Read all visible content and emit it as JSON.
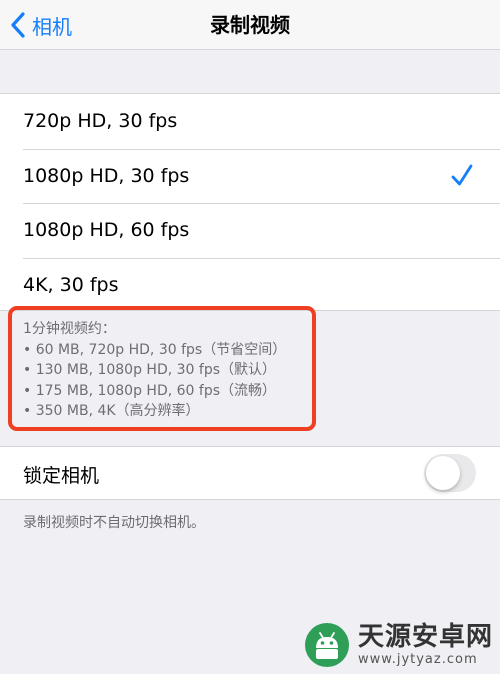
{
  "navbar": {
    "back_label": "相机",
    "title": "录制视频"
  },
  "resolutions": [
    {
      "label": "720p HD, 30 fps",
      "selected": false
    },
    {
      "label": "1080p HD, 30 fps",
      "selected": true
    },
    {
      "label": "1080p HD, 60 fps",
      "selected": false
    },
    {
      "label": "4K, 30 fps",
      "selected": false
    }
  ],
  "footnote": {
    "heading": "1分钟视频约：",
    "lines": [
      "• 60 MB, 720p HD, 30 fps（节省空间）",
      "• 130 MB, 1080p HD, 30 fps（默认）",
      "• 175 MB, 1080p HD, 60 fps（流畅）",
      "• 350 MB, 4K（高分辨率）"
    ]
  },
  "lock_camera": {
    "label": "锁定相机",
    "enabled": false,
    "description": "录制视频时不自动切换相机。"
  },
  "watermark": {
    "name": "天源安卓网",
    "url": "www.jytyaz.com"
  },
  "colors": {
    "accent": "#147efb",
    "highlight": "#ef3f22",
    "watermark_logo": "#2f9f58"
  }
}
